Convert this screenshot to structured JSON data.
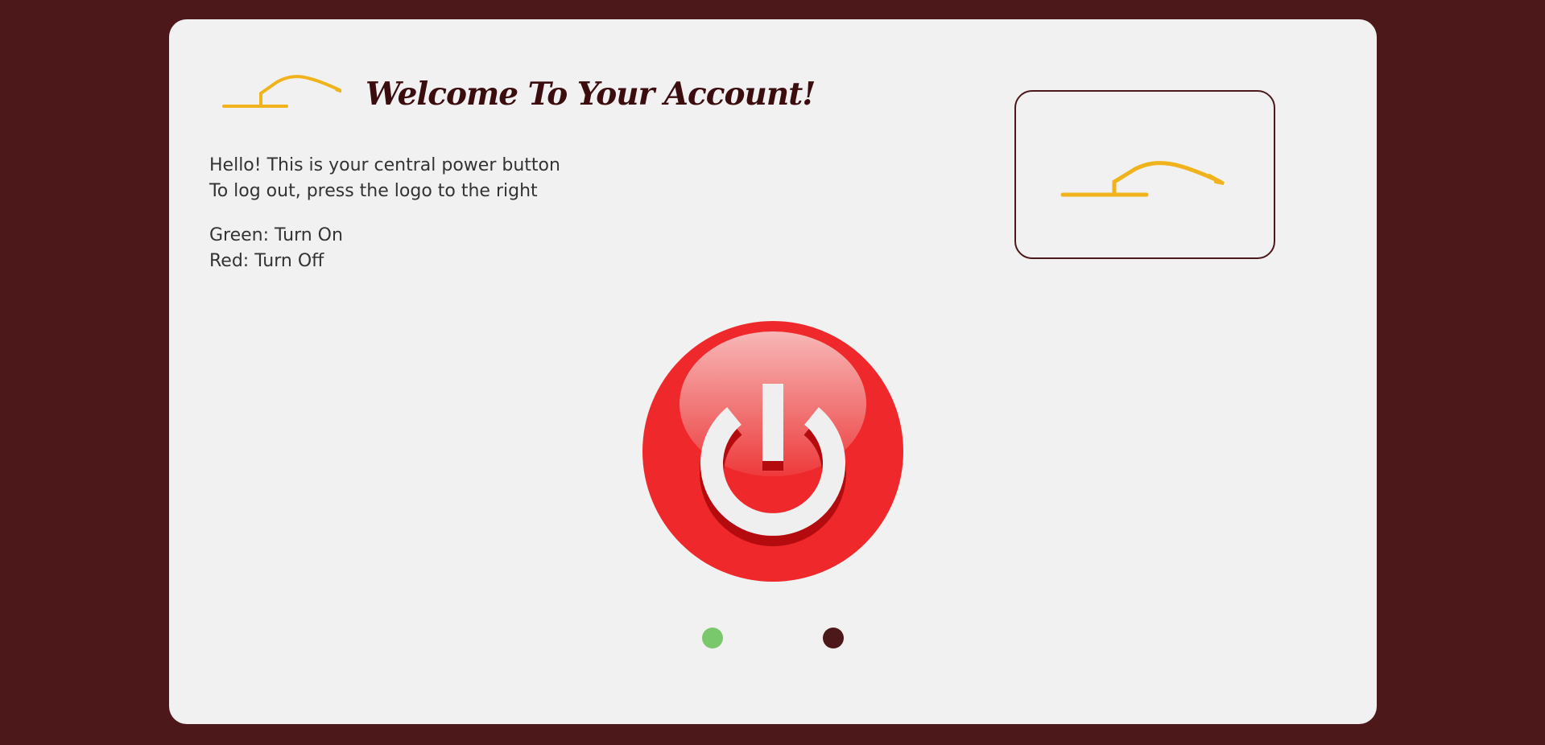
{
  "header": {
    "title": "Welcome To Your Account!",
    "logo_icon": "house-roof-logo-icon"
  },
  "intro": {
    "line1": "Hello! This is your central power button",
    "line2": "To log out, press the logo to the right",
    "line3": "Green: Turn On",
    "line4": "Red: Turn Off"
  },
  "logout": {
    "icon": "house-roof-logo-icon"
  },
  "power": {
    "icon": "power-icon",
    "state": "off"
  },
  "indicators": [
    {
      "name": "on-indicator",
      "color": "#79c86b"
    },
    {
      "name": "off-indicator",
      "color": "#4c181a"
    }
  ],
  "colors": {
    "background": "#4c181a",
    "card": "#f1f1f1",
    "title": "#3b0d0f",
    "logo": "#f0b31c",
    "power_button": "#ef292b"
  }
}
